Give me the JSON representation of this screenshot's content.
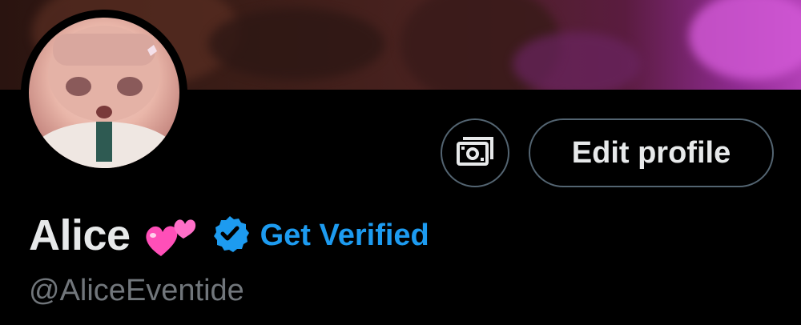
{
  "profile": {
    "display_name": "Alice",
    "handle": "@AliceEventide",
    "name_emoji": "two-hearts-icon"
  },
  "actions": {
    "subscriptions_icon": "money-icon",
    "edit_profile_label": "Edit profile"
  },
  "verification": {
    "badge_icon": "verified-badge-icon",
    "label": "Get Verified"
  },
  "colors": {
    "background": "#000000",
    "text_primary": "#e7e9ea",
    "text_secondary": "#71767b",
    "accent": "#1d9bf0",
    "border": "#536471",
    "heart_pink": "#ff4fb8"
  }
}
